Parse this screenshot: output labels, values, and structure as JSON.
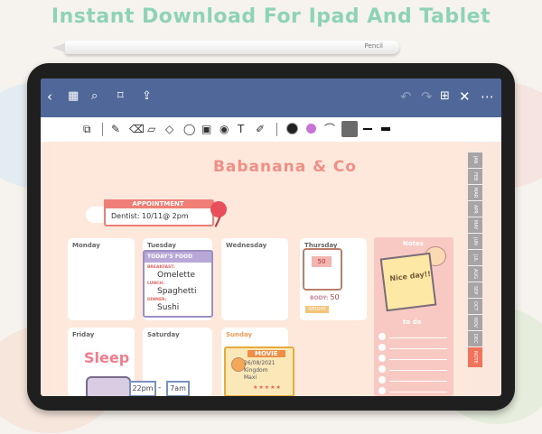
{
  "headline": "Instant Download For Ipad And Tablet",
  "pencil": {
    "label": "Pencil"
  },
  "topbar": {
    "icons": [
      "back-icon",
      "grid-icon",
      "search-icon",
      "bookmark-icon",
      "share-icon",
      "undo-icon",
      "redo-icon",
      "add-page-icon",
      "close-icon",
      "more-icon"
    ]
  },
  "toolbar": {
    "tools": [
      "crop-tool-icon",
      "pen-icon",
      "eraser-icon",
      "highlighter-icon",
      "shapes-icon",
      "lasso-icon",
      "image-icon",
      "camera-icon",
      "text-icon",
      "marker-icon"
    ],
    "colors": [
      "#222222",
      "#c874d6"
    ]
  },
  "planner": {
    "brand": "Babanana & Co",
    "appointment": {
      "title": "APPOINTMENT",
      "text": "Dentist: 10/11@ 2pm"
    },
    "days": [
      "Monday",
      "Tuesday",
      "Wednesday",
      "Thursday",
      "Friday",
      "Saturday",
      "Sunday"
    ],
    "food": {
      "title": "TODAY'S FOOD",
      "breakfast_label": "BREAKFAST:",
      "breakfast": "Omelette",
      "lunch_label": "LUNCH:",
      "lunch": "Spaghetti",
      "dinner_label": "DINNER:",
      "dinner": "Sushi"
    },
    "weight": {
      "screen": "50",
      "label": "BODY:",
      "value": "50",
      "tag": "WEIGHT"
    },
    "sleep": {
      "title": "Sleep",
      "from": "22pm",
      "dash": "-",
      "to": "7am"
    },
    "movie": {
      "title": "MOVIE",
      "rows": [
        "26/08/2021",
        "Kingdom",
        "Maxi"
      ],
      "stars": "★★★★★"
    },
    "notes": {
      "title": "Notes",
      "sticky": "Nice day!!",
      "todo": "to do"
    },
    "tabs": [
      "JAN",
      "FEB",
      "MAR",
      "APR",
      "MAY",
      "JUN",
      "JUL",
      "AUG",
      "SEP",
      "OCT",
      "NOV",
      "DEC",
      "NOTE"
    ]
  }
}
